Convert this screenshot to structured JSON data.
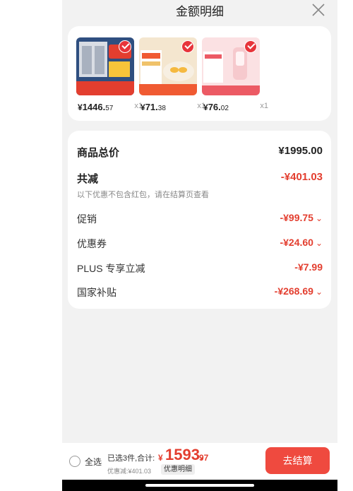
{
  "header": {
    "title": "金额明细",
    "close_icon": "close-icon"
  },
  "products": [
    {
      "price_yen": "¥",
      "price_int": "1446.",
      "price_dec": "57",
      "qty": "x1",
      "colors": [
        "#3a5d8f",
        "#e33e2f"
      ]
    },
    {
      "price_yen": "¥",
      "price_int": "71.",
      "price_dec": "38",
      "qty": "x1",
      "colors": [
        "#f2e0c0",
        "#f05a32"
      ]
    },
    {
      "price_yen": "¥",
      "price_int": "76.",
      "price_dec": "02",
      "qty": "x1",
      "colors": [
        "#f8d6d8",
        "#ec5a64"
      ]
    }
  ],
  "summary": {
    "total_label": "商品总价",
    "total_value": "¥1995.00",
    "save_label": "共减",
    "save_value": "-¥401.03",
    "note": "以下优惠不包含红包，请在结算页查看",
    "items": [
      {
        "label": "促销",
        "value": "-¥99.75",
        "caret": "⌄"
      },
      {
        "label": "优惠券",
        "value": "-¥24.60",
        "caret": "⌄"
      },
      {
        "label": "PLUS 专享立减",
        "value": "-¥7.99",
        "caret": ""
      },
      {
        "label": "国家补贴",
        "value": "-¥268.69",
        "caret": "⌄"
      }
    ]
  },
  "footer": {
    "select_all": "全选",
    "selected_text": "已选3件,合计:",
    "sum_yen": "¥",
    "sum_int": "1593.",
    "sum_dec": "97",
    "discount_text": "优惠减:¥401.03",
    "detail_tag": "优惠明细",
    "checkout": "去结算"
  },
  "colors": {
    "accent": "#e33e2f",
    "button": "#ef4a3f"
  }
}
